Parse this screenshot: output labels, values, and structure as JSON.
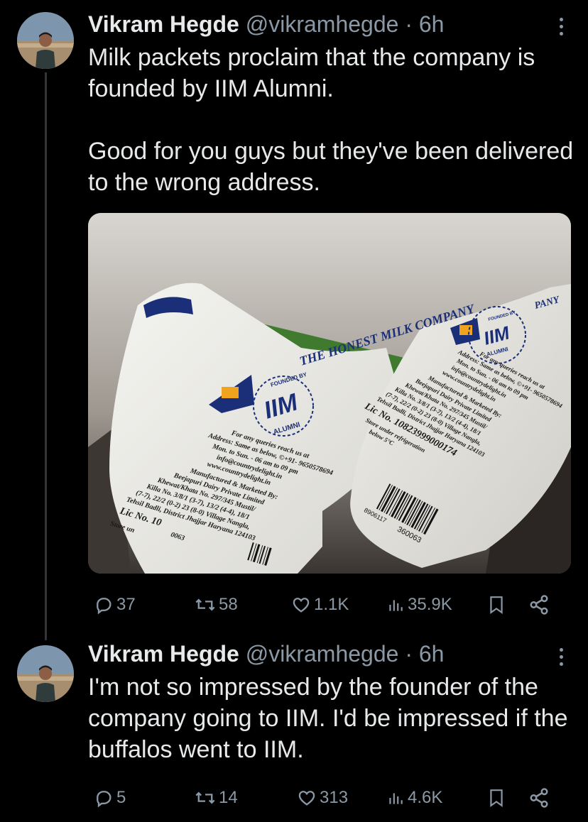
{
  "tweets": [
    {
      "author": {
        "name": "Vikram Hegde",
        "handle": "@vikramhegde",
        "time": "· 6h"
      },
      "text": [
        "Milk packets proclaim that the company is founded by IIM Alumni.",
        "Good for you guys but they've been delivered to the wrong address."
      ],
      "media": {
        "brand_big": "THE HONEST MILK COMPANY",
        "brand_right": "PANY",
        "stamp_top": "FOUNDED BY",
        "stamp_main": "IIM",
        "stamp_bottom": "ALUMNI",
        "queries": "For any queries reach us at",
        "address": "Address: Same as below, ©+91- 9650578694",
        "hours": "Mon. to Sun. - 06 am to 09 pm",
        "email": "info@countrydelight.in",
        "web": "www.countrydelight.in",
        "mfd": "Manufactured & Marketed By:",
        "dairy": "Beejapuri Dairy Private Limited",
        "khata": "Khewat/Khata No. 297/345 Mustil/",
        "killa": "Killa No. 3/8/1 (3-7), 13/2 (4-4), 18/1",
        "survey": "(7-7), 22/2 (0-2) 23 (8-0) Village Nangla,",
        "tehsil": "Tehsil Badli, District Jhajjar Haryana 124103",
        "lic": "Lic No. 10823999000174",
        "store": "Store under refrigeration",
        "temp": "below 5°C",
        "barcode": "360063",
        "barcode_left": "8906117",
        "lic_short": "Lic No. 10",
        "store_short": "Store un",
        "code_short": "0063"
      },
      "stats": {
        "replies": "37",
        "reposts": "58",
        "likes": "1.1K",
        "views": "35.9K"
      }
    },
    {
      "author": {
        "name": "Vikram Hegde",
        "handle": "@vikramhegde",
        "time": "· 6h"
      },
      "text": [
        "I'm not so impressed by the founder of the company going to IIM. I'd be impressed if the buffalos went to IIM."
      ],
      "stats": {
        "replies": "5",
        "reposts": "14",
        "likes": "313",
        "views": "4.6K"
      }
    }
  ]
}
